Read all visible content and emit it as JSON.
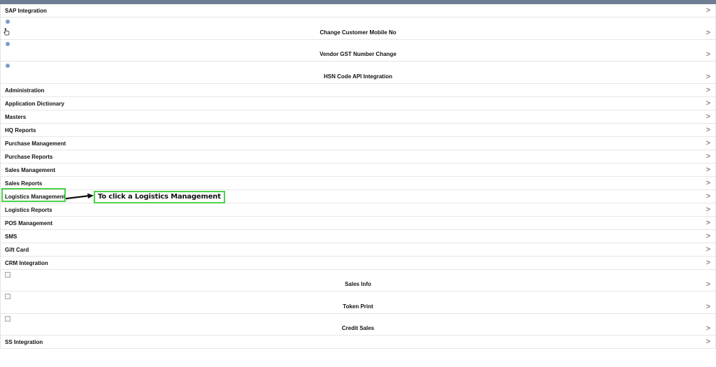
{
  "menu": {
    "sap_integration": "SAP Integration",
    "change_customer_mobile": "Change Customer Mobile No",
    "vendor_gst_change": "Vendor GST Number Change",
    "hsn_code_api": "HSN Code API Integration",
    "administration": "Administration",
    "application_dictionary": "Application Dictionary",
    "masters": "Masters",
    "hq_reports": "HQ Reports",
    "purchase_management": "Purchase Management",
    "purchase_reports": "Purchase Reports",
    "sales_management": "Sales Management",
    "sales_reports": "Sales Reports",
    "logistics_management": "Logistics Management",
    "logistics_reports": "Logistics Reports",
    "pos_management": "POS Management",
    "sms": "SMS",
    "gift_card": "Gift Card",
    "crm_integration": "CRM Integration",
    "sales_info": "Sales Info",
    "token_print": "Token Print",
    "credit_sales": "Credit Sales",
    "ss_integration": "SS Integration"
  },
  "chevron": ">",
  "annotation": {
    "callout_text": "To click a Logistics Management",
    "highlight_color": "#4cd24c"
  },
  "icons": {
    "hand_cursor": "hand-pointer-icon",
    "bullet": "bullet-dot-icon",
    "checkbox": "checkbox-icon",
    "chevron": "chevron-right-icon"
  }
}
